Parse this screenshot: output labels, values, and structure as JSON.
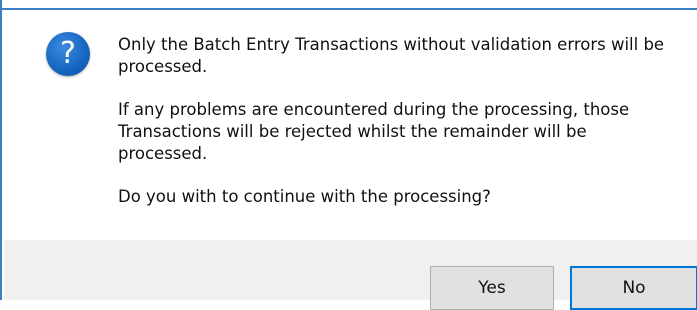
{
  "dialog": {
    "icon": "question-icon",
    "icon_glyph": "?",
    "message": {
      "line1": "Only the Batch Entry Transactions without validation errors will be processed.",
      "line2": "If any problems are encountered during the processing, those Transactions will be rejected whilst the remainder will be processed.",
      "line3": "Do you with to continue with the processing?"
    },
    "buttons": {
      "yes_label": "Yes",
      "no_label": "No"
    }
  },
  "colors": {
    "window_border": "#3b7fc4",
    "icon_blue": "#1565c0",
    "footer_bg": "#f0f0f0",
    "focus_border": "#0078d7"
  }
}
